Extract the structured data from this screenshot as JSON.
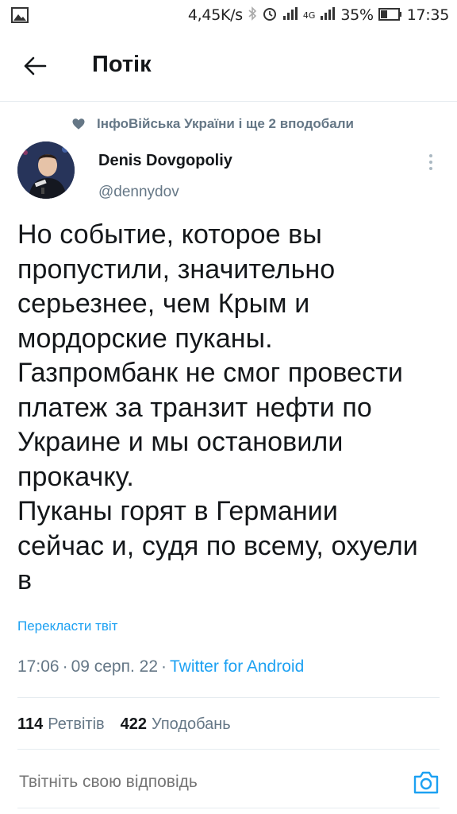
{
  "status_bar": {
    "speed": "4,45K/s",
    "network": "4G",
    "battery": "35%",
    "time": "17:35"
  },
  "header": {
    "title": "Потік"
  },
  "social_context": {
    "text": "ІнфоВійська України і ще 2 вподобали"
  },
  "author": {
    "name": "Denis Dovgopoliy",
    "handle": "@dennydov"
  },
  "tweet": {
    "lines": [
      "Но событие, которое вы",
      "пропустили, значительно",
      "серьезнее, чем Крым и",
      "мордорские пуканы.",
      "Газпромбанк не смог провести",
      "платеж за транзит нефти по",
      "Украине и мы остановили",
      "прокачку.",
      "Пуканы горят в Германии",
      "сейчас и, судя по всему, охуели",
      "в"
    ],
    "translate_label": "Перекласти твіт",
    "time": "17:06",
    "date": "09 серп. 22",
    "source": "Twitter for Android"
  },
  "stats": {
    "retweets_count": "114",
    "retweets_label": "Ретвітів",
    "likes_count": "422",
    "likes_label": "Уподобань"
  },
  "reply": {
    "placeholder": "Твітніть свою відповідь"
  },
  "colors": {
    "accent": "#1da1f2",
    "secondary_text": "#657786",
    "primary_text": "#14171a",
    "divider": "#e6ecf0"
  }
}
